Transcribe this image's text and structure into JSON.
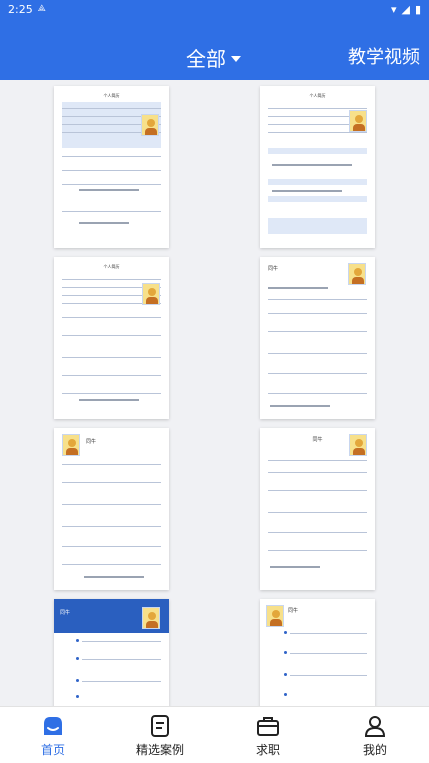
{
  "status_bar": {
    "time": "2:25",
    "left_icon": "notification-icon",
    "right_icons": [
      "wifi-icon",
      "signal-icon",
      "battery-icon"
    ]
  },
  "top_bar": {
    "filter_label": "全部",
    "video_label": "教学视频"
  },
  "cards": [
    {
      "title": "个人简历"
    },
    {
      "title": "个人简历"
    },
    {
      "title": "个人简历"
    },
    {
      "title": "同牛"
    },
    {
      "title": "同牛"
    },
    {
      "title": "同牛"
    },
    {
      "title": "同牛"
    },
    {
      "title": "同牛"
    }
  ],
  "tab_bar": {
    "items": [
      {
        "label": "首页",
        "icon": "home-icon",
        "active": true
      },
      {
        "label": "精选案例",
        "icon": "document-icon",
        "active": false
      },
      {
        "label": "求职",
        "icon": "briefcase-icon",
        "active": false
      },
      {
        "label": "我的",
        "icon": "user-icon",
        "active": false
      }
    ]
  },
  "colors": {
    "primary": "#2f6fe5",
    "background": "#f0f1f4",
    "tab_active": "#2f6fe5"
  }
}
